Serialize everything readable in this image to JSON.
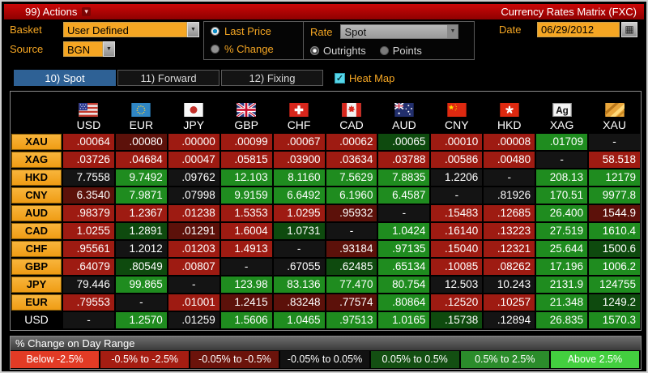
{
  "titlebar": {
    "actions_label": "99) Actions",
    "title": "Currency Rates Matrix (FXC)"
  },
  "controls": {
    "basket_label": "Basket",
    "basket_value": "User Defined",
    "source_label": "Source",
    "source_value": "BGN",
    "price_radios": [
      {
        "label": "Last Price",
        "selected": true
      },
      {
        "label": "% Change",
        "selected": false
      }
    ],
    "rate_label": "Rate",
    "rate_value": "Spot",
    "rate_radios": [
      {
        "label": "Outrights",
        "selected": true
      },
      {
        "label": "Points",
        "selected": false
      }
    ],
    "date_label": "Date",
    "date_value": "06/29/2012"
  },
  "tabs": [
    {
      "label": "10) Spot",
      "active": true
    },
    {
      "label": "11) Forward",
      "active": false
    },
    {
      "label": "12) Fixing",
      "active": false
    }
  ],
  "heat_map": {
    "label": "Heat Map",
    "checked": true
  },
  "matrix": {
    "columns": [
      {
        "code": "USD",
        "flag": "us"
      },
      {
        "code": "EUR",
        "flag": "eu"
      },
      {
        "code": "JPY",
        "flag": "jp"
      },
      {
        "code": "GBP",
        "flag": "gb"
      },
      {
        "code": "CHF",
        "flag": "ch"
      },
      {
        "code": "CAD",
        "flag": "ca"
      },
      {
        "code": "AUD",
        "flag": "au"
      },
      {
        "code": "CNY",
        "flag": "cn"
      },
      {
        "code": "HKD",
        "flag": "hk"
      },
      {
        "code": "XAG",
        "flag": "xag"
      },
      {
        "code": "XAU",
        "flag": "xau"
      }
    ],
    "rows": [
      {
        "label": "XAU",
        "orange": true,
        "cells": [
          {
            "v": ".00064",
            "c": "r"
          },
          {
            "v": ".00080",
            "c": "dr"
          },
          {
            "v": ".00000",
            "c": "r"
          },
          {
            "v": ".00099",
            "c": "r"
          },
          {
            "v": ".00067",
            "c": "r"
          },
          {
            "v": ".00062",
            "c": "r"
          },
          {
            "v": ".00065",
            "c": "dg"
          },
          {
            "v": ".00010",
            "c": "r"
          },
          {
            "v": ".00008",
            "c": "r"
          },
          {
            "v": ".01709",
            "c": "g"
          },
          {
            "v": "-",
            "c": "k"
          }
        ]
      },
      {
        "label": "XAG",
        "orange": true,
        "cells": [
          {
            "v": ".03726",
            "c": "r"
          },
          {
            "v": ".04684",
            "c": "r"
          },
          {
            "v": ".00047",
            "c": "r"
          },
          {
            "v": ".05815",
            "c": "r"
          },
          {
            "v": ".03900",
            "c": "r"
          },
          {
            "v": ".03634",
            "c": "r"
          },
          {
            "v": ".03788",
            "c": "r"
          },
          {
            "v": ".00586",
            "c": "r"
          },
          {
            "v": ".00480",
            "c": "r"
          },
          {
            "v": "-",
            "c": "k"
          },
          {
            "v": "58.518",
            "c": "r"
          }
        ]
      },
      {
        "label": "HKD",
        "orange": true,
        "cells": [
          {
            "v": "7.7558",
            "c": "k"
          },
          {
            "v": "9.7492",
            "c": "g"
          },
          {
            "v": ".09762",
            "c": "k"
          },
          {
            "v": "12.103",
            "c": "g"
          },
          {
            "v": "8.1160",
            "c": "g"
          },
          {
            "v": "7.5629",
            "c": "g"
          },
          {
            "v": "7.8835",
            "c": "g"
          },
          {
            "v": "1.2206",
            "c": "k"
          },
          {
            "v": "-",
            "c": "k"
          },
          {
            "v": "208.13",
            "c": "g"
          },
          {
            "v": "12179",
            "c": "g"
          }
        ]
      },
      {
        "label": "CNY",
        "orange": true,
        "cells": [
          {
            "v": "6.3540",
            "c": "dr"
          },
          {
            "v": "7.9871",
            "c": "g"
          },
          {
            "v": ".07998",
            "c": "k"
          },
          {
            "v": "9.9159",
            "c": "g"
          },
          {
            "v": "6.6492",
            "c": "g"
          },
          {
            "v": "6.1960",
            "c": "g"
          },
          {
            "v": "6.4587",
            "c": "g"
          },
          {
            "v": "-",
            "c": "k"
          },
          {
            "v": ".81926",
            "c": "k"
          },
          {
            "v": "170.51",
            "c": "g"
          },
          {
            "v": "9977.8",
            "c": "g"
          }
        ]
      },
      {
        "label": "AUD",
        "orange": true,
        "cells": [
          {
            "v": ".98379",
            "c": "r"
          },
          {
            "v": "1.2367",
            "c": "r"
          },
          {
            "v": ".01238",
            "c": "r"
          },
          {
            "v": "1.5353",
            "c": "r"
          },
          {
            "v": "1.0295",
            "c": "r"
          },
          {
            "v": ".95932",
            "c": "dr"
          },
          {
            "v": "-",
            "c": "k"
          },
          {
            "v": ".15483",
            "c": "r"
          },
          {
            "v": ".12685",
            "c": "r"
          },
          {
            "v": "26.400",
            "c": "g"
          },
          {
            "v": "1544.9",
            "c": "dr"
          }
        ]
      },
      {
        "label": "CAD",
        "orange": true,
        "cells": [
          {
            "v": "1.0255",
            "c": "r"
          },
          {
            "v": "1.2891",
            "c": "dg"
          },
          {
            "v": ".01291",
            "c": "dr"
          },
          {
            "v": "1.6004",
            "c": "r"
          },
          {
            "v": "1.0731",
            "c": "dg"
          },
          {
            "v": "-",
            "c": "k"
          },
          {
            "v": "1.0424",
            "c": "g"
          },
          {
            "v": ".16140",
            "c": "r"
          },
          {
            "v": ".13223",
            "c": "r"
          },
          {
            "v": "27.519",
            "c": "g"
          },
          {
            "v": "1610.4",
            "c": "g"
          }
        ]
      },
      {
        "label": "CHF",
        "orange": true,
        "cells": [
          {
            "v": ".95561",
            "c": "r"
          },
          {
            "v": "1.2012",
            "c": "k"
          },
          {
            "v": ".01203",
            "c": "r"
          },
          {
            "v": "1.4913",
            "c": "r"
          },
          {
            "v": "-",
            "c": "k"
          },
          {
            "v": ".93184",
            "c": "dr"
          },
          {
            "v": ".97135",
            "c": "g"
          },
          {
            "v": ".15040",
            "c": "r"
          },
          {
            "v": ".12321",
            "c": "r"
          },
          {
            "v": "25.644",
            "c": "g"
          },
          {
            "v": "1500.6",
            "c": "dg"
          }
        ]
      },
      {
        "label": "GBP",
        "orange": true,
        "cells": [
          {
            "v": ".64079",
            "c": "r"
          },
          {
            "v": ".80549",
            "c": "dg"
          },
          {
            "v": ".00807",
            "c": "r"
          },
          {
            "v": "-",
            "c": "k"
          },
          {
            "v": ".67055",
            "c": "k"
          },
          {
            "v": ".62485",
            "c": "dg"
          },
          {
            "v": ".65134",
            "c": "g"
          },
          {
            "v": ".10085",
            "c": "r"
          },
          {
            "v": ".08262",
            "c": "r"
          },
          {
            "v": "17.196",
            "c": "g"
          },
          {
            "v": "1006.2",
            "c": "g"
          }
        ]
      },
      {
        "label": "JPY",
        "orange": true,
        "cells": [
          {
            "v": "79.446",
            "c": "k"
          },
          {
            "v": "99.865",
            "c": "g"
          },
          {
            "v": "-",
            "c": "k"
          },
          {
            "v": "123.98",
            "c": "g"
          },
          {
            "v": "83.136",
            "c": "g"
          },
          {
            "v": "77.470",
            "c": "g"
          },
          {
            "v": "80.754",
            "c": "g"
          },
          {
            "v": "12.503",
            "c": "k"
          },
          {
            "v": "10.243",
            "c": "k"
          },
          {
            "v": "2131.9",
            "c": "g"
          },
          {
            "v": "124755",
            "c": "g"
          }
        ]
      },
      {
        "label": "EUR",
        "orange": true,
        "cells": [
          {
            "v": ".79553",
            "c": "r"
          },
          {
            "v": "-",
            "c": "k"
          },
          {
            "v": ".01001",
            "c": "r"
          },
          {
            "v": "1.2415",
            "c": "dr"
          },
          {
            "v": ".83248",
            "c": "dr"
          },
          {
            "v": ".77574",
            "c": "dr"
          },
          {
            "v": ".80864",
            "c": "g"
          },
          {
            "v": ".12520",
            "c": "r"
          },
          {
            "v": ".10257",
            "c": "r"
          },
          {
            "v": "21.348",
            "c": "g"
          },
          {
            "v": "1249.2",
            "c": "dg"
          }
        ]
      },
      {
        "label": "USD",
        "orange": false,
        "cells": [
          {
            "v": "-",
            "c": "k"
          },
          {
            "v": "1.2570",
            "c": "g"
          },
          {
            "v": ".01259",
            "c": "k"
          },
          {
            "v": "1.5606",
            "c": "g"
          },
          {
            "v": "1.0465",
            "c": "g"
          },
          {
            "v": ".97513",
            "c": "g"
          },
          {
            "v": "1.0165",
            "c": "g"
          },
          {
            "v": ".15738",
            "c": "dg"
          },
          {
            "v": ".12894",
            "c": "k"
          },
          {
            "v": "26.835",
            "c": "g"
          },
          {
            "v": "1570.3",
            "c": "g"
          }
        ]
      }
    ]
  },
  "legend": {
    "title": "% Change on Day Range",
    "ranges": [
      {
        "label": "Below -2.5%",
        "color": "#e23b25"
      },
      {
        "label": "-0.5% to -2.5%",
        "color": "#a51d12"
      },
      {
        "label": "-0.05% to -0.5%",
        "color": "#6b130b"
      },
      {
        "label": "-0.05% to 0.05%",
        "color": "#121212"
      },
      {
        "label": "0.05% to 0.5%",
        "color": "#134f12"
      },
      {
        "label": "0.5% to 2.5%",
        "color": "#2b8c2b"
      },
      {
        "label": "Above 2.5%",
        "color": "#43cf3f"
      }
    ]
  },
  "colors": {
    "cell": {
      "r": "#9e1b12",
      "dr": "#5c110a",
      "k": "#141414",
      "dg": "#0e4a0e",
      "g": "#1f8c1f"
    },
    "accent_orange": "#f5a623",
    "tab_active_blue": "#2e6195",
    "titlebar_red": "#b30505",
    "checkbox_cyan": "#56d7ea"
  }
}
